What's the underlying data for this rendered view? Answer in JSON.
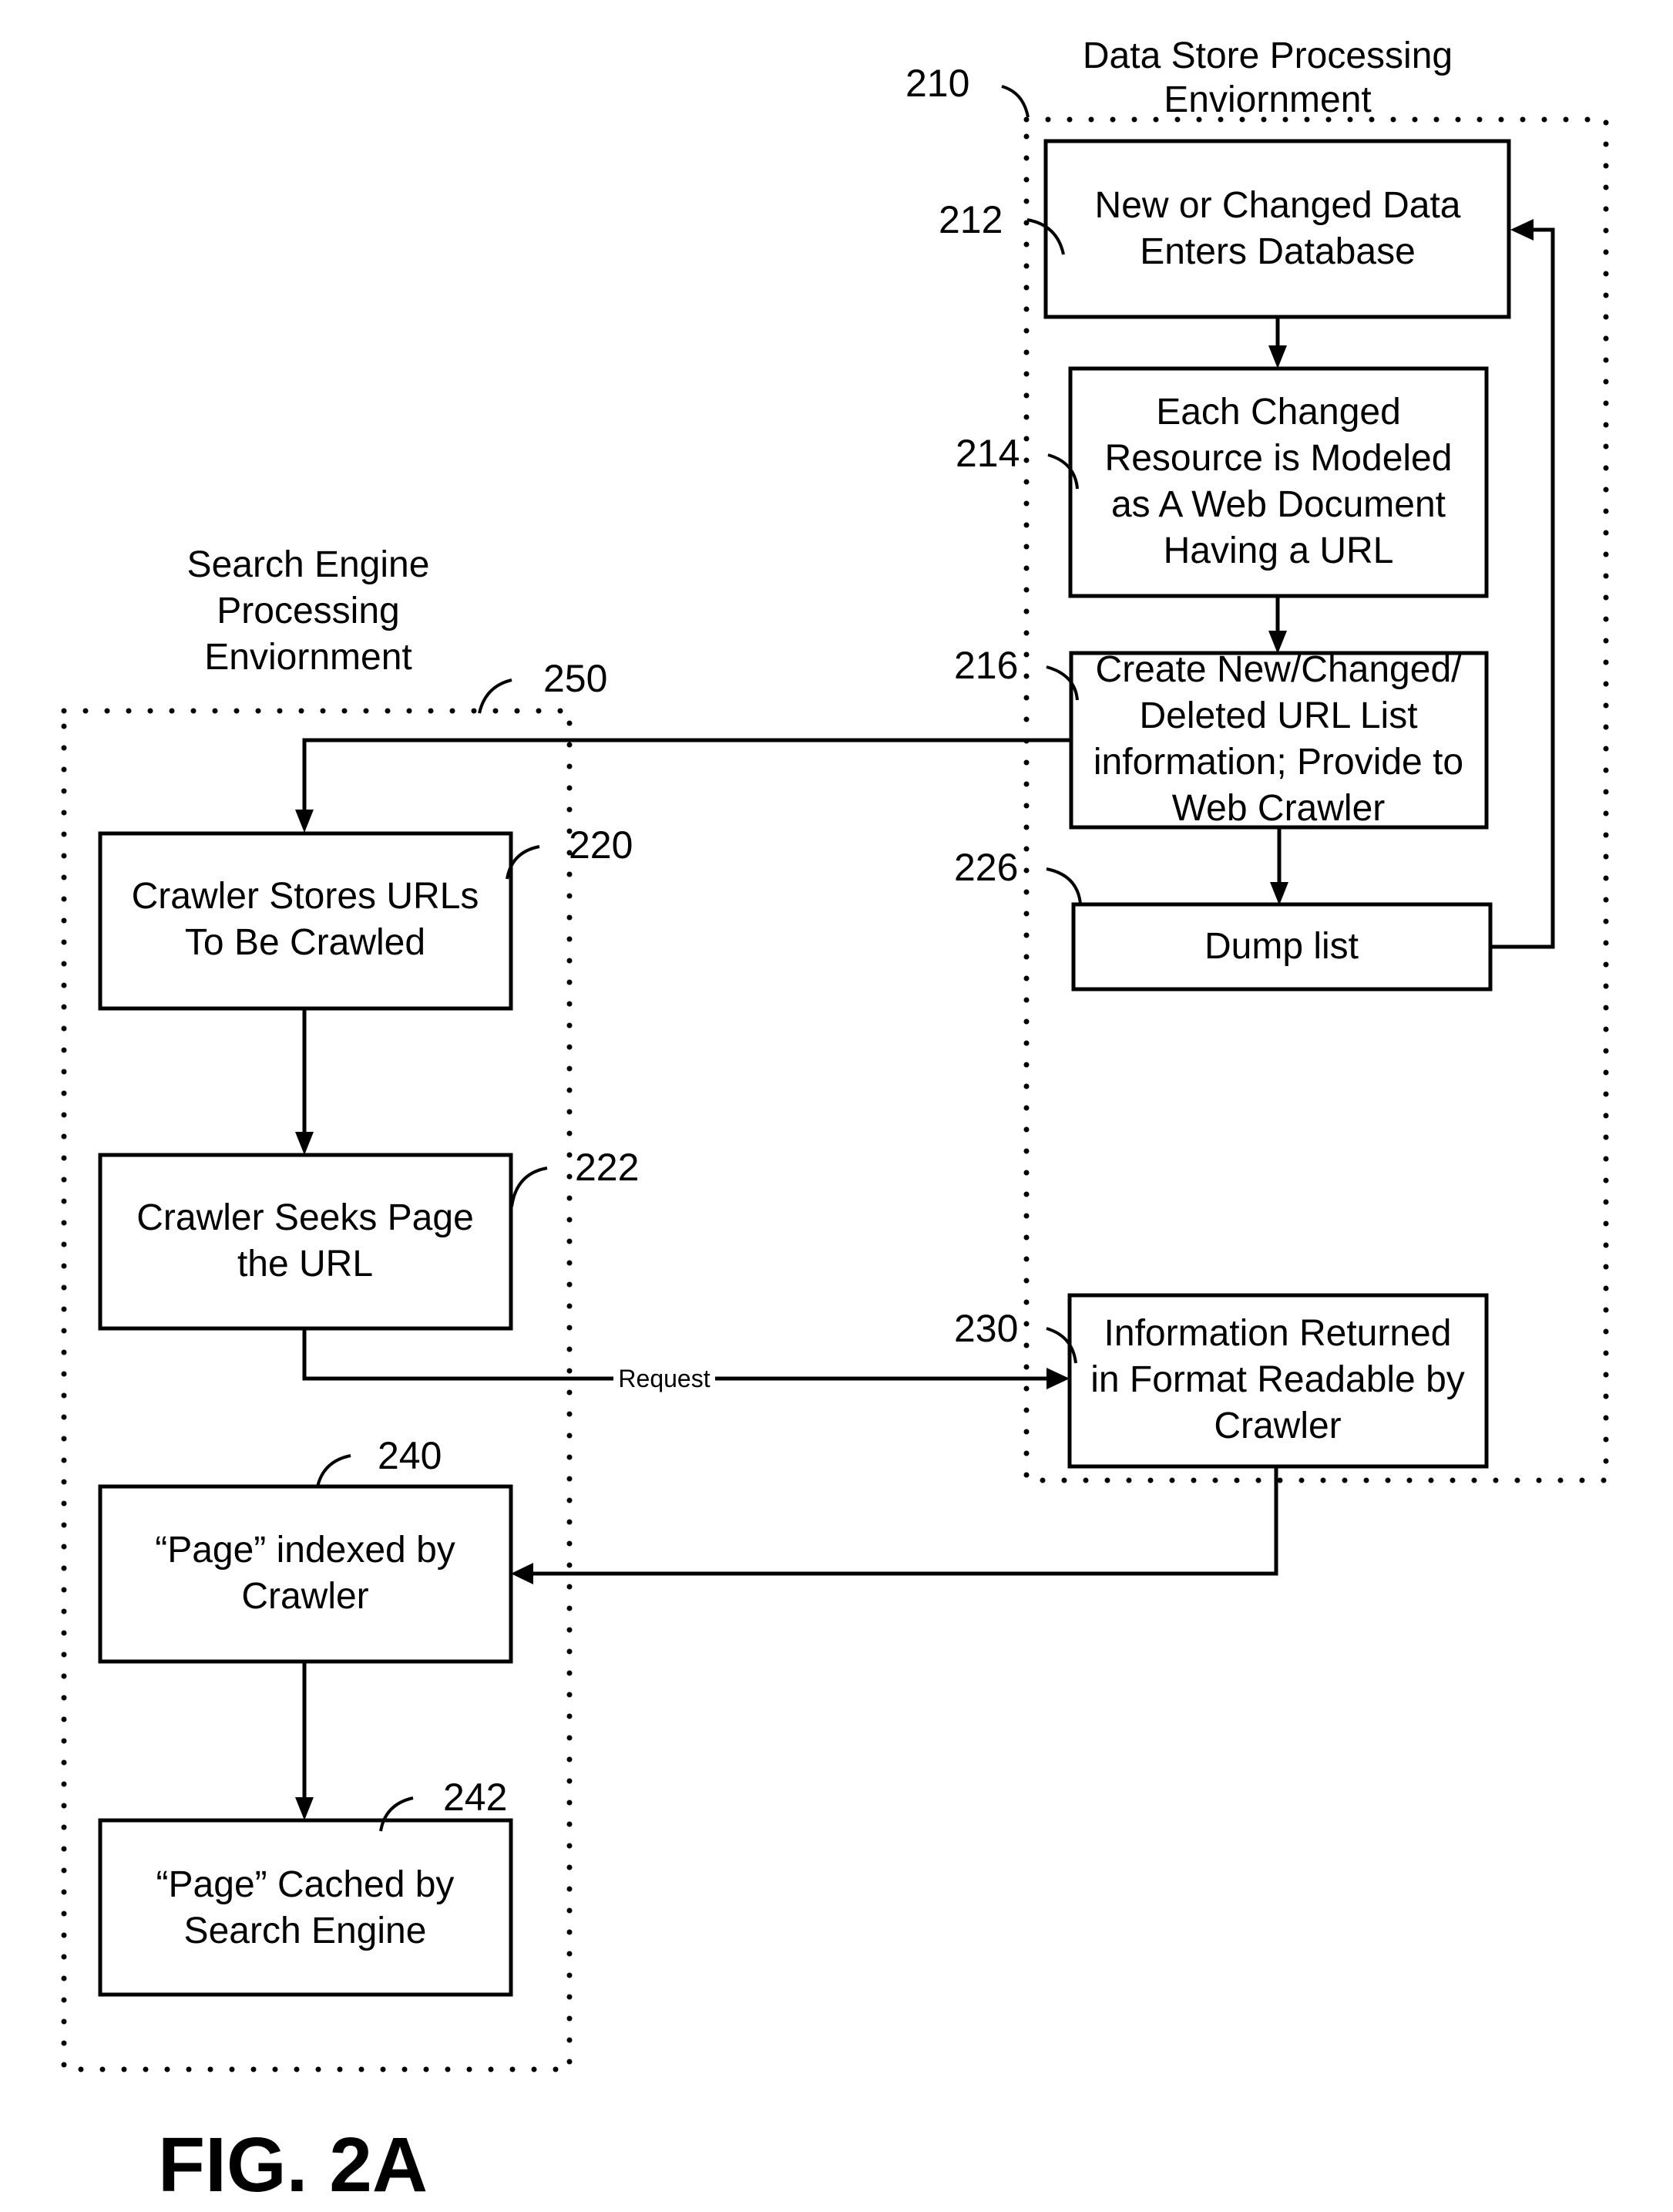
{
  "figure": {
    "caption": "FIG. 2A",
    "environments": {
      "data_store": {
        "ref": "210",
        "title_lines": [
          "Data Store Processing",
          "Enviornment"
        ]
      },
      "search_engine": {
        "ref": "250",
        "title_lines": [
          "Search Engine",
          "Processing",
          "Enviornment"
        ]
      }
    },
    "steps": {
      "s212": {
        "ref": "212",
        "lines": [
          "New or Changed Data",
          "Enters Database"
        ]
      },
      "s214": {
        "ref": "214",
        "lines": [
          "Each Changed",
          "Resource is Modeled",
          "as A Web Document",
          "Having a URL"
        ]
      },
      "s216": {
        "ref": "216",
        "lines": [
          "Create New/Changed/",
          "Deleted URL List",
          "information; Provide to",
          "Web Crawler"
        ]
      },
      "s226": {
        "ref": "226",
        "lines": [
          "Dump list"
        ]
      },
      "s220": {
        "ref": "220",
        "lines": [
          "Crawler Stores URLs",
          "To Be Crawled"
        ]
      },
      "s222": {
        "ref": "222",
        "lines": [
          "Crawler Seeks Page",
          "the URL"
        ]
      },
      "s230": {
        "ref": "230",
        "lines": [
          "Information Returned",
          "in Format Readable by",
          "Crawler"
        ]
      },
      "s240": {
        "ref": "240",
        "lines": [
          "“Page” indexed by",
          "Crawler"
        ]
      },
      "s242": {
        "ref": "242",
        "lines": [
          "“Page” Cached  by",
          "Search Engine"
        ]
      }
    },
    "connectors": {
      "request_label": "Request"
    }
  }
}
